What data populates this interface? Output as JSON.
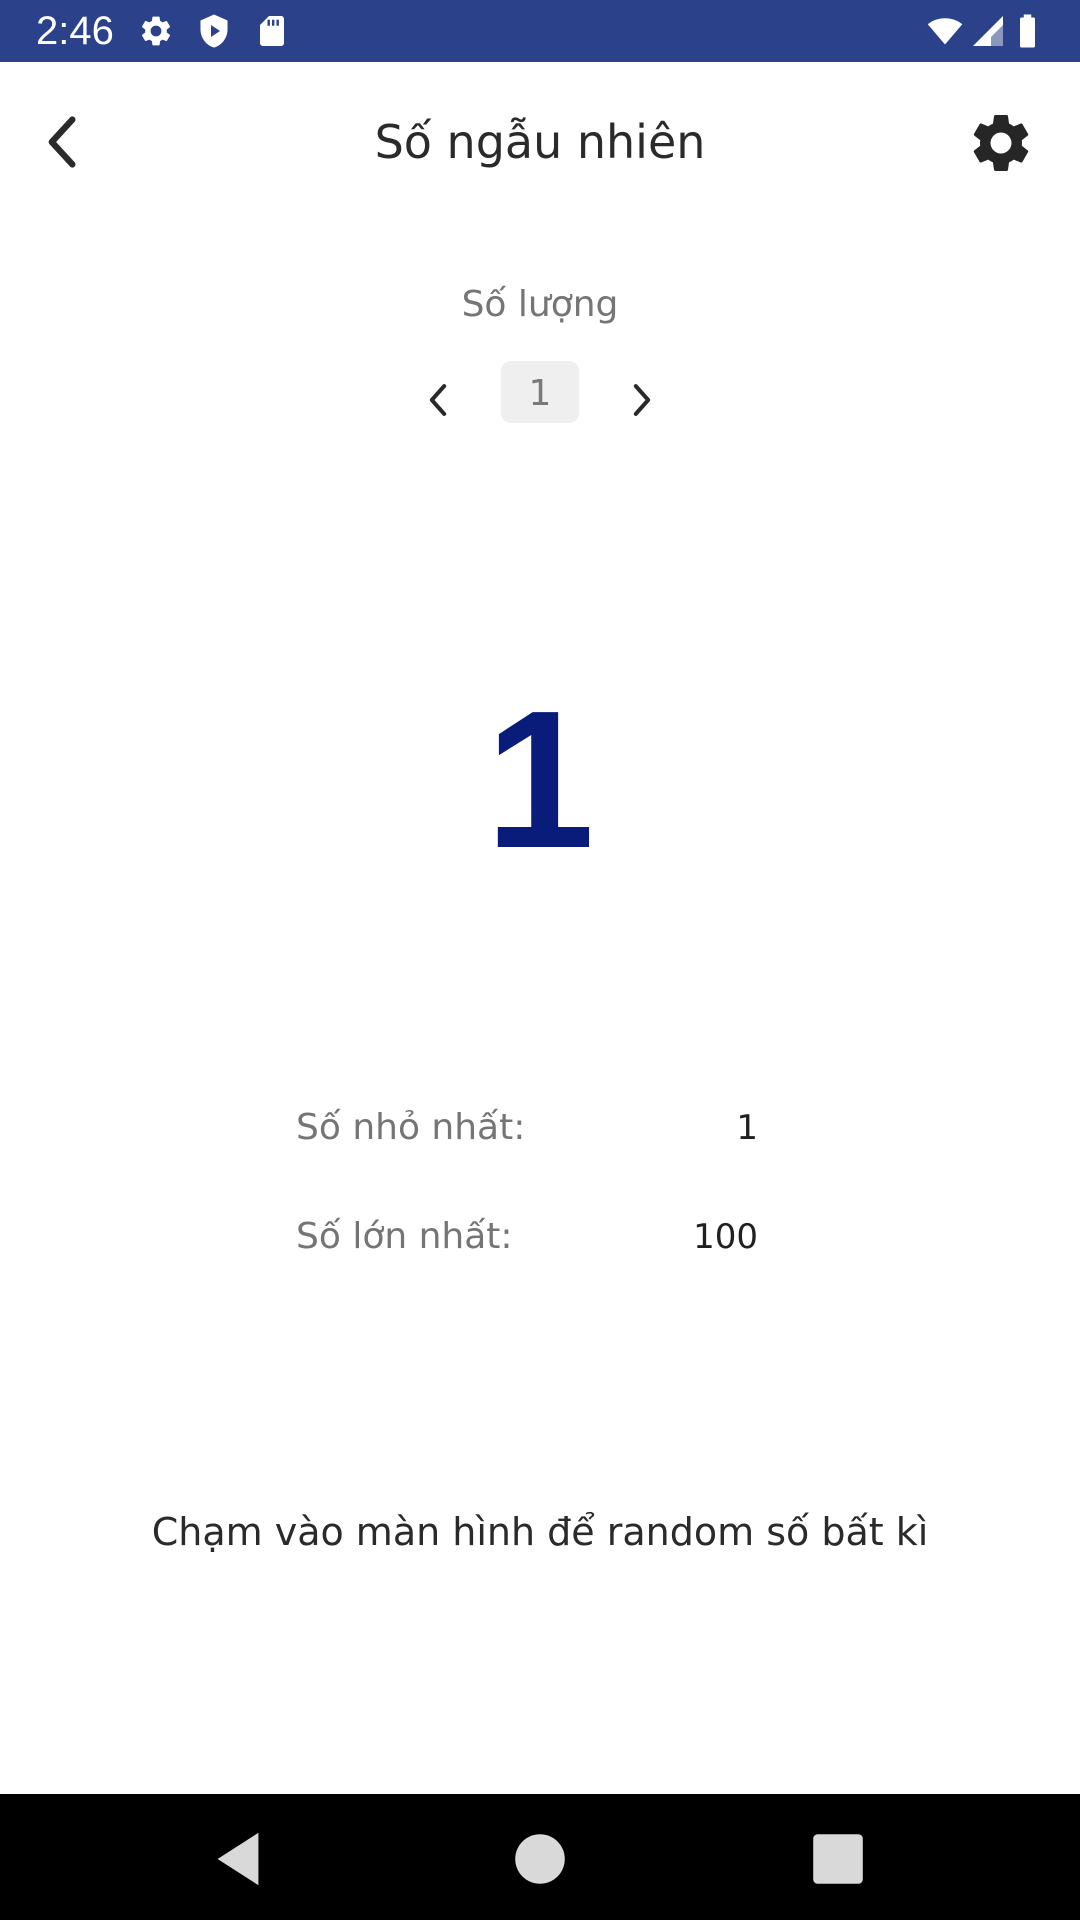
{
  "status_bar": {
    "time": "2:46",
    "background": "#2b428b",
    "icons": [
      "gear-icon",
      "shield-icon",
      "sd-card-icon",
      "wifi-icon",
      "cellular-signal-icon",
      "battery-icon"
    ]
  },
  "app_bar": {
    "title": "Số ngẫu nhiên",
    "back_icon": "chevron-left-icon",
    "settings_icon": "gear-icon"
  },
  "quantity": {
    "label": "Số lượng",
    "value": "1",
    "prev_icon": "chevron-left-icon",
    "next_icon": "chevron-right-icon"
  },
  "result": {
    "value": "1",
    "color": "#0a1c7a"
  },
  "range": {
    "min_label": "Số nhỏ nhất:",
    "min_value": "1",
    "max_label": "Số lớn nhất:",
    "max_value": "100"
  },
  "hint": {
    "text": "Chạm vào màn hình để random số bất kì"
  },
  "nav_bar": {
    "icons": [
      "back-triangle-icon",
      "home-circle-icon",
      "recents-square-icon"
    ]
  }
}
